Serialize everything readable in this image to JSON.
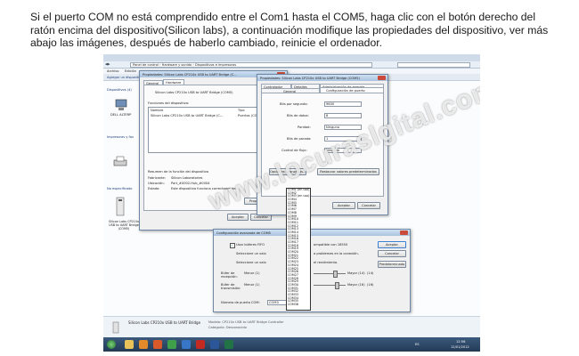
{
  "caption": "Si el puerto COM no está comprendido entre el Com1 hasta el COM5, haga clic con el botón derecho del ratón encima del dispositivo(Silicon labs), a continuación modifique las propiedades del dispositivo, ver más abajo las imágenes, después de haberlo cambiado, reinicie el ordenador.",
  "watermark": "www.locuraslgital.com",
  "explorer": {
    "breadcrumb": "Panel de control › Hardware y sonido › Dispositivos e impresoras",
    "menu": [
      "Archivo",
      "Edición"
    ],
    "command": "Agregar un dispositivo",
    "sections": [
      "Dispositivos (4)",
      "Impresoras y fax",
      "No especificado"
    ],
    "pc_label": "DELL ALTERP",
    "usb_label": "Silicon Labs CP210x USB to UART Bridge (COM5)",
    "status_name": "Silicon Labs CP210x USB to UART Bridge",
    "status_model": "Modelo: CP210x USB to UART Bridge Controller",
    "status_cat": "Categoría: Desconocido"
  },
  "props1": {
    "title": "Propiedades: Silicon Labs CP210x USB to UART Bridge (C...",
    "tabs": [
      "General",
      "Hardware"
    ],
    "device": "Silicon Labs CP210x USB to UART Bridge (COM5)",
    "functions_label": "Funciones del dispositivo:",
    "col_name": "Nombre",
    "col_type": "Tipo",
    "row_name": "Silicon Labs CP210x USB to UART Bridge (C...",
    "row_type": "Puertos (CO...",
    "summary": "Resumen de la función del dispositivo",
    "maker_k": "Fabricante:",
    "maker_v": "Silicon Laboratories",
    "loc_k": "Ubicación:",
    "loc_v": "Port_#0002.Hub_#0004",
    "state_k": "Estado:",
    "state_v": "Este dispositivo funciona correctamente.",
    "props_btn": "Propiedades",
    "ok": "Aceptar",
    "cancel": "Cancelar"
  },
  "props2": {
    "title": "Propiedades: Silicon Labs CP210x USB to UART Bridge (COM5)",
    "tabs_top": [
      "Controlador",
      "Detalles",
      "Administración de energía"
    ],
    "tabs_bottom": [
      "General",
      "Configuración de puerto"
    ],
    "fields": [
      {
        "label": "Bits por segundo:",
        "value": "9600"
      },
      {
        "label": "Bits de datos:",
        "value": "8"
      },
      {
        "label": "Paridad:",
        "value": "Ninguno"
      },
      {
        "label": "Bits de parada:",
        "value": "1"
      },
      {
        "label": "Control de flujo:",
        "value": "Ninguno"
      }
    ],
    "advanced_btn": "Opciones avanzadas...",
    "restore_btn": "Restaurar valores predeterminados",
    "ok": "Aceptar",
    "cancel": "Cancelar"
  },
  "adv": {
    "title": "Configuración avanzada de COM5",
    "fifo": "Usar búferes FIFO",
    "compat": "ompatible con 16550",
    "sel1": "Seleccione un valo",
    "sel1_tail": "a problemas en la conexión.",
    "sel2": "Seleccione un valo",
    "sel2_tail": "el rendimiento.",
    "rx": "Búfer de recepción:",
    "rx_minor": "Menor (1)",
    "rx_major": "Mayor (14)",
    "rx_val": "(14)",
    "tx": "Búfer de transmisión:",
    "tx_minor": "Menor (1)",
    "tx_major": "Mayor (16)",
    "tx_val": "(16)",
    "port_label": "Número de puerto COM:",
    "port_value": "COM3",
    "ok": "Aceptar",
    "cancel": "Cancelar",
    "defaults": "Predeterminado"
  },
  "com_list": [
    "COM1 (en uso)",
    "COM2",
    "COM3 (en uso)",
    "COM4",
    "COM5",
    "COM6",
    "COM7",
    "COM8",
    "COM9",
    "COM10",
    "COM11",
    "COM12",
    "COM13",
    "COM14",
    "COM15",
    "COM16",
    "COM17",
    "COM18",
    "COM19",
    "COM20",
    "COM21",
    "COM22",
    "COM23",
    "COM24",
    "COM25",
    "COM26",
    "COM27",
    "COM28",
    "COM29",
    "COM30",
    "COM31",
    "COM32",
    "COM33",
    "COM34",
    "COM35",
    "COM36"
  ],
  "com_selected": "COM3",
  "taskbar": {
    "time": "12:56",
    "date": "12/01/2012",
    "lang": "ES"
  },
  "colors": {
    "accent": "#3169c6",
    "taskbar": "#233a55",
    "window_title": "#a9c3df"
  },
  "icons": [
    "start-orb-icon",
    "folder-icon",
    "media-player-icon",
    "firefox-icon",
    "chrome-icon",
    "explorer-icon",
    "pdf-icon",
    "word-icon",
    "excel-icon",
    "usb-device-icon",
    "printer-icon",
    "computer-icon"
  ]
}
